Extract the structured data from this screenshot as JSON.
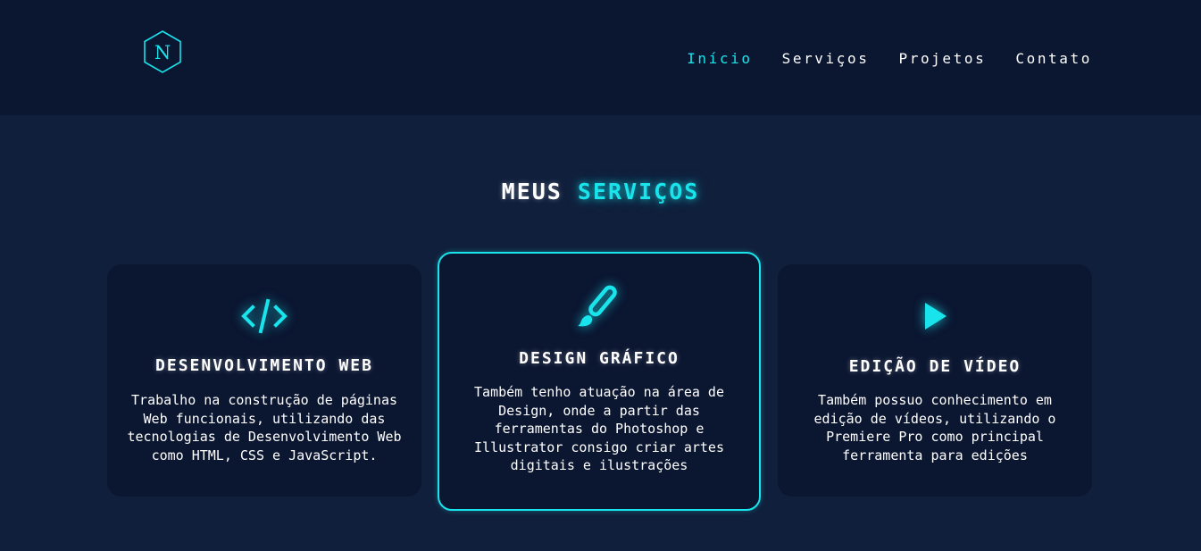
{
  "header": {
    "logo_letter": "N",
    "nav": [
      {
        "label": "Início",
        "active": true
      },
      {
        "label": "Serviços",
        "active": false
      },
      {
        "label": "Projetos",
        "active": false
      },
      {
        "label": "Contato",
        "active": false
      }
    ]
  },
  "services": {
    "title_plain": "Meus",
    "title_accent": "Serviços",
    "cards": [
      {
        "icon": "code-icon",
        "title": "Desenvolvimento Web",
        "text": "Trabalho na construção de páginas Web funcionais, utilizando das tecnologias de Desenvolvimento Web como HTML, CSS e JavaScript."
      },
      {
        "icon": "paintbrush-icon",
        "title": "Design Gráfico",
        "text": "Também tenho atuação na área de Design, onde a partir das ferramentas do Photoshop e Illustrator consigo criar artes digitais e ilustrações"
      },
      {
        "icon": "play-icon",
        "title": "Edição de Vídeo",
        "text": "Também possuo conhecimento em edição de vídeos, utilizando o Premiere Pro como principal ferramenta para edições"
      }
    ]
  },
  "colors": {
    "accent": "#19e4ec",
    "header_bg": "#0b1631",
    "page_bg": "#101f3c",
    "card_bg": "#0b1631"
  }
}
